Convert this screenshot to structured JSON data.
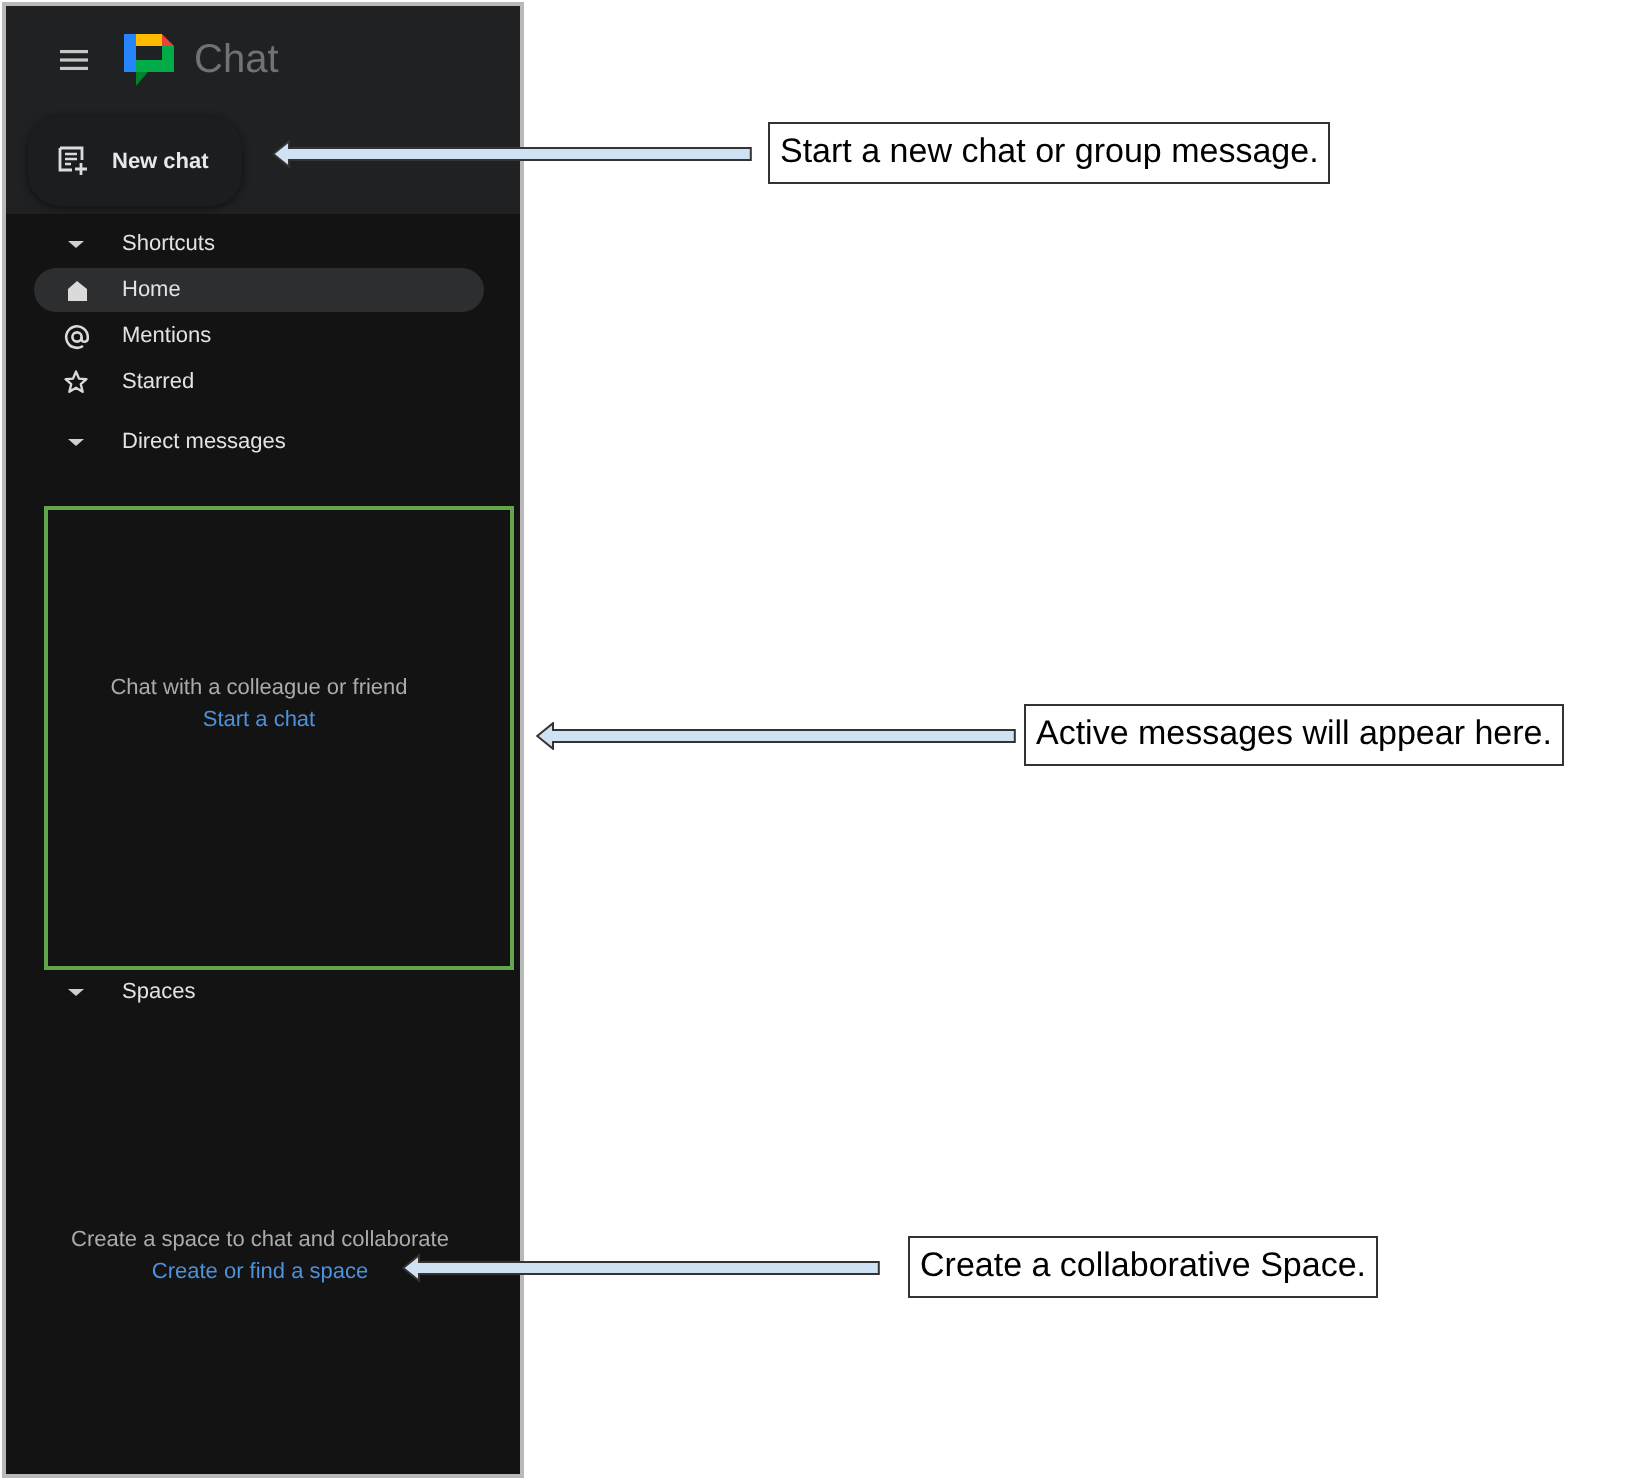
{
  "sidebar": {
    "app_name": "Chat",
    "new_chat_button": "New chat",
    "sections": [
      {
        "title": "Shortcuts",
        "expanded": true,
        "items": [
          {
            "label": "Home",
            "selected": true
          },
          {
            "label": "Mentions",
            "selected": false
          },
          {
            "label": "Starred",
            "selected": false
          }
        ]
      },
      {
        "title": "Direct messages",
        "expanded": true,
        "highlighted": true,
        "empty_state": {
          "text": "Chat with a colleague or friend",
          "link": "Start a chat"
        }
      },
      {
        "title": "Spaces",
        "expanded": true,
        "empty_state": {
          "text": "Create a space to chat and collaborate",
          "link": "Create or find a space"
        }
      }
    ]
  },
  "annotations": [
    {
      "text": "Start a new chat or group message."
    },
    {
      "text": "Active messages will appear here."
    },
    {
      "text": "Create a collaborative Space."
    }
  ]
}
